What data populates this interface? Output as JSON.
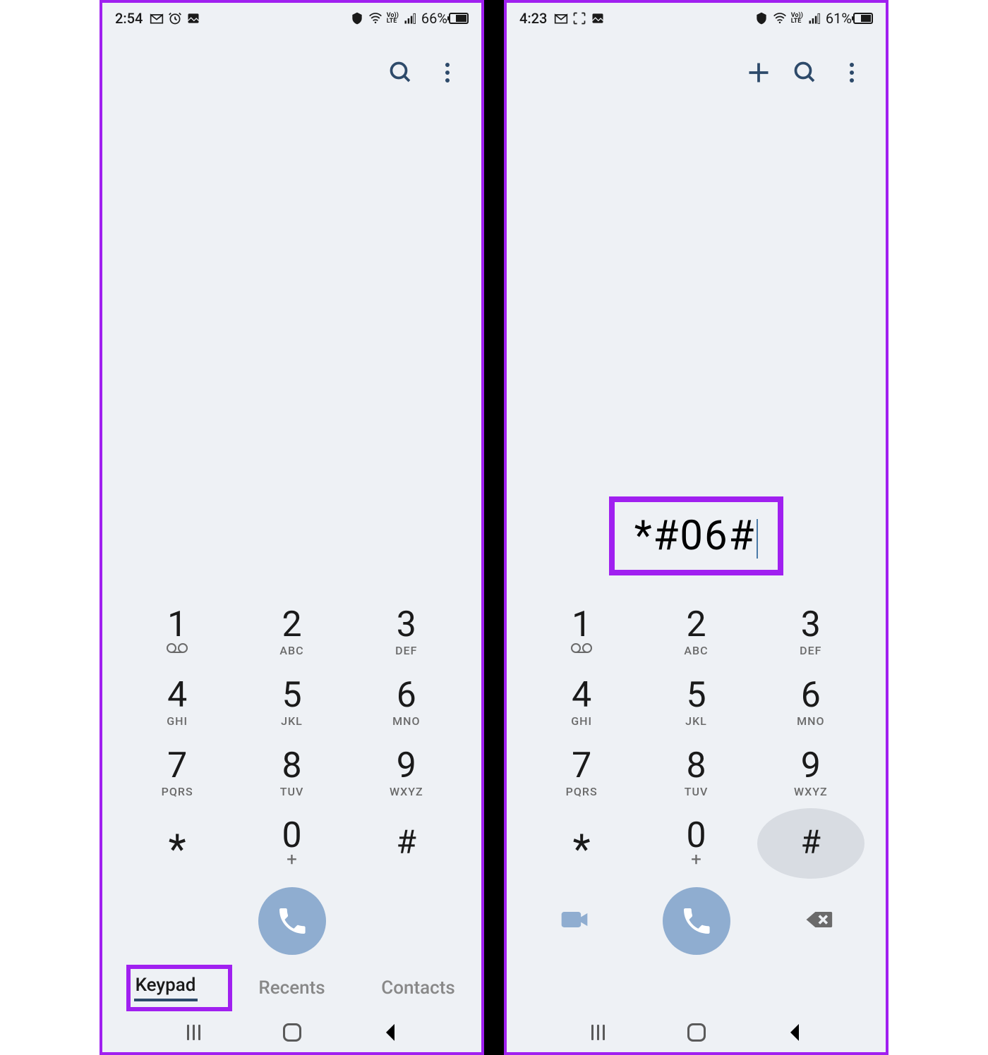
{
  "left": {
    "status": {
      "time": "2:54",
      "battery_pct": "66%",
      "battery_fill": 64
    },
    "toolbar": {
      "show_plus": false
    },
    "dialed": "",
    "show_tabs": true,
    "action_mode": "call_only",
    "highlight_keypad_tab": true
  },
  "right": {
    "status": {
      "time": "4:23",
      "battery_pct": "61%",
      "battery_fill": 60
    },
    "toolbar": {
      "show_plus": true
    },
    "dialed": "*#06#",
    "show_tabs": false,
    "action_mode": "three",
    "highlight_dialed": true,
    "pressed_key": "#"
  },
  "keypad": [
    {
      "digit": "1",
      "sub": "voicemail"
    },
    {
      "digit": "2",
      "sub": "ABC"
    },
    {
      "digit": "3",
      "sub": "DEF"
    },
    {
      "digit": "4",
      "sub": "GHI"
    },
    {
      "digit": "5",
      "sub": "JKL"
    },
    {
      "digit": "6",
      "sub": "MNO"
    },
    {
      "digit": "7",
      "sub": "PQRS"
    },
    {
      "digit": "8",
      "sub": "TUV"
    },
    {
      "digit": "9",
      "sub": "WXYZ"
    },
    {
      "digit": "*",
      "sub": ""
    },
    {
      "digit": "0",
      "sub": "+"
    },
    {
      "digit": "#",
      "sub": ""
    }
  ],
  "tabs": [
    {
      "id": "keypad",
      "label": "Keypad",
      "active": true
    },
    {
      "id": "recents",
      "label": "Recents",
      "active": false
    },
    {
      "id": "contacts",
      "label": "Contacts",
      "active": false
    }
  ]
}
